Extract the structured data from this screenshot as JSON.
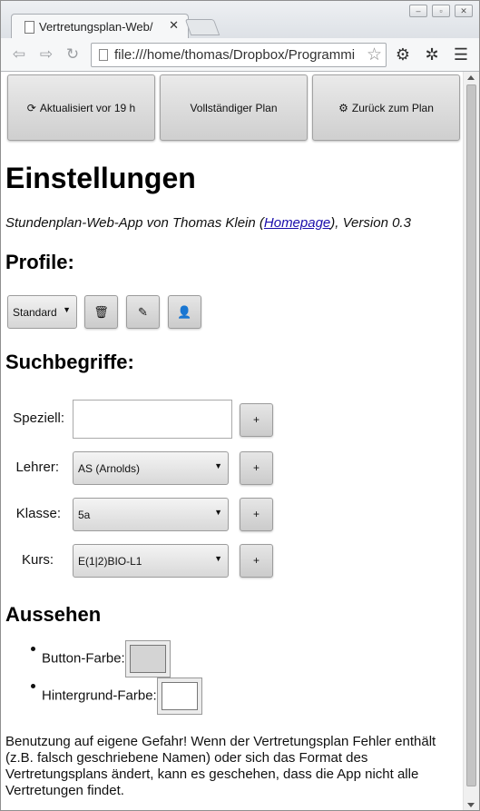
{
  "browser": {
    "tab_title": "Vertretungsplan-Web/",
    "tab_close": "✕",
    "url": "file:///home/thomas/Dropbox/Programmi"
  },
  "top_buttons": {
    "refresh_label": "Aktualisiert vor 19 h",
    "full_plan_label": "Vollständiger Plan",
    "back_label": "Zurück zum Plan"
  },
  "page": {
    "title": "Einstellungen",
    "subtitle_prefix": "Stundenplan-Web-App von Thomas Klein (",
    "subtitle_link": "Homepage",
    "subtitle_suffix": "), Version 0.3"
  },
  "profiles": {
    "heading": "Profile:",
    "selected": "Standard"
  },
  "search": {
    "heading": "Suchbegriffe:",
    "special_label": "Speziell:",
    "special_value": "",
    "teacher_label": "Lehrer:",
    "teacher_value": "AS (Arnolds)",
    "class_label": "Klasse:",
    "class_value": "5a",
    "course_label": "Kurs:",
    "course_value": "E(1|2)BIO-L1",
    "add_label": "+"
  },
  "appearance": {
    "heading": "Aussehen",
    "button_color_label": "Button-Farbe:",
    "button_color": "#d4d4d4",
    "background_color_label": "Hintergrund-Farbe:",
    "background_color": "#ffffff"
  },
  "disclaimer": "Benutzung auf eigene Gefahr! Wenn der Vertretungsplan Fehler enthält (z.B. falsch geschriebene Namen) oder sich das Format des Vertretungsplans ändert, kann es geschehen, dass die App nicht alle Vertretungen findet."
}
